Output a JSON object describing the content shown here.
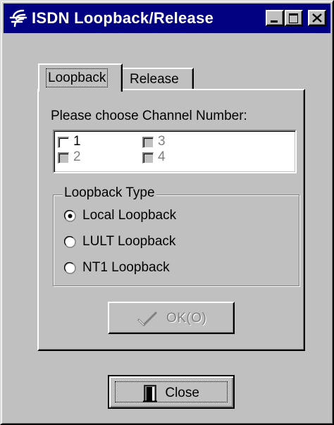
{
  "window": {
    "title": "ISDN Loopback/Release",
    "title_icon": "isdn-app-icon",
    "controls": [
      "minimize",
      "maximize",
      "close"
    ]
  },
  "tabs": [
    {
      "label": "Loopback",
      "active": true
    },
    {
      "label": "Release",
      "active": false
    }
  ],
  "channels": {
    "label": "Please choose Channel Number:",
    "items": [
      {
        "label": "1",
        "enabled": true,
        "checked": false
      },
      {
        "label": "2",
        "enabled": false,
        "checked": false
      },
      {
        "label": "3",
        "enabled": false,
        "checked": false
      },
      {
        "label": "4",
        "enabled": false,
        "checked": false
      }
    ]
  },
  "loopback_type": {
    "legend": "Loopback Type",
    "options": [
      {
        "label": "Local Loopback",
        "selected": true
      },
      {
        "label": "LULT Loopback",
        "selected": false
      },
      {
        "label": "NT1 Loopback",
        "selected": false
      }
    ]
  },
  "buttons": {
    "ok": {
      "label": "OK(O)",
      "enabled": false,
      "icon": "checkmark-icon"
    },
    "close": {
      "label": "Close",
      "icon": "door-icon"
    }
  },
  "colors": {
    "face": "#c0c0c0",
    "titlebar": "#000080",
    "disabled_text": "#808080"
  }
}
